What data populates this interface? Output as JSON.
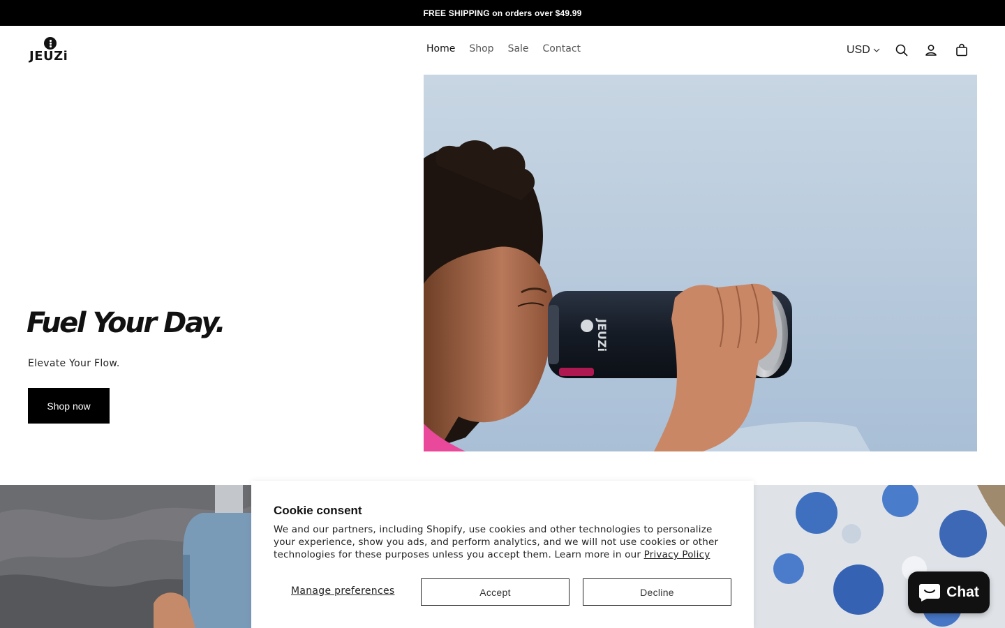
{
  "announcement": {
    "text": "FREE SHIPPING on orders over $49.99"
  },
  "header": {
    "logo_text": "JEUZi",
    "nav": [
      {
        "label": "Home"
      },
      {
        "label": "Shop"
      },
      {
        "label": "Sale"
      },
      {
        "label": "Contact"
      }
    ],
    "currency": "USD",
    "icons": [
      "search-icon",
      "account-icon",
      "cart-icon"
    ]
  },
  "hero": {
    "title": "Fuel Your Day.",
    "subtitle": "Elevate Your Flow.",
    "button_label": "Shop now",
    "bottle_logo": "JEUZi"
  },
  "cookie": {
    "title": "Cookie consent",
    "body": "We and our partners, including Shopify, use cookies and other technologies to personalize your experience, show you ads, and perform analytics, and we will not use cookies or other technologies for these purposes unless you accept them. Learn more in our ",
    "privacy_link": "Privacy Policy",
    "manage_label": "Manage preferences",
    "accept_label": "Accept",
    "decline_label": "Decline"
  },
  "chat": {
    "label": "Chat"
  },
  "colors": {
    "announcement_bg": "#000000",
    "button_bg": "#000000",
    "sky": "#c9d6e2"
  }
}
